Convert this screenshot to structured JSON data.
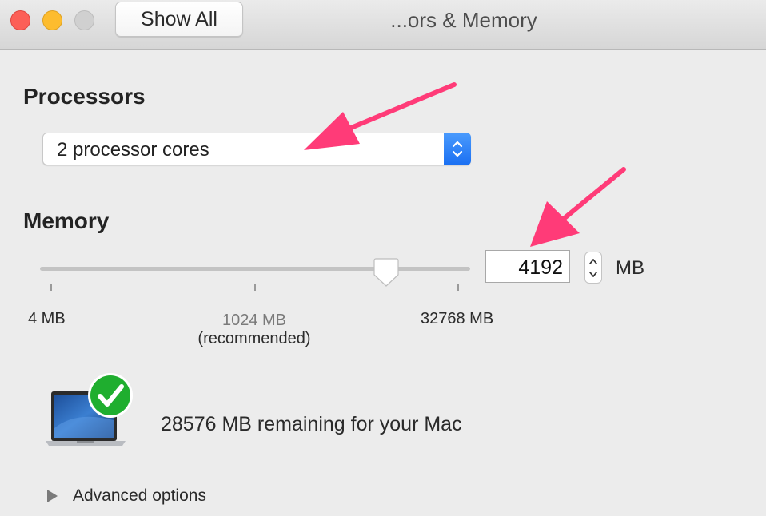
{
  "window": {
    "title": "...ors & Memory",
    "show_all_label": "Show All",
    "traffic_lights": [
      "close",
      "minimize",
      "zoom"
    ]
  },
  "processors": {
    "heading": "Processors",
    "selected_option": "2 processor cores"
  },
  "memory": {
    "heading": "Memory",
    "slider": {
      "min_label": "4 MB",
      "recommended_value_label": "1024 MB",
      "recommended_note": "(recommended)",
      "max_label": "32768 MB"
    },
    "value": "4192",
    "unit": "MB"
  },
  "status": {
    "remaining_text": "28576 MB remaining for your Mac"
  },
  "advanced": {
    "label": "Advanced options"
  },
  "colors": {
    "accent": "#1a6ff2",
    "annotation_arrow": "#ff3b78",
    "check_green": "#1fae2f"
  },
  "icons": {
    "laptop": "laptop-icon",
    "check": "checkmark-badge-icon",
    "disclosure": "disclosure-triangle-icon",
    "popup_chevrons": "up-down-chevron-icon"
  }
}
